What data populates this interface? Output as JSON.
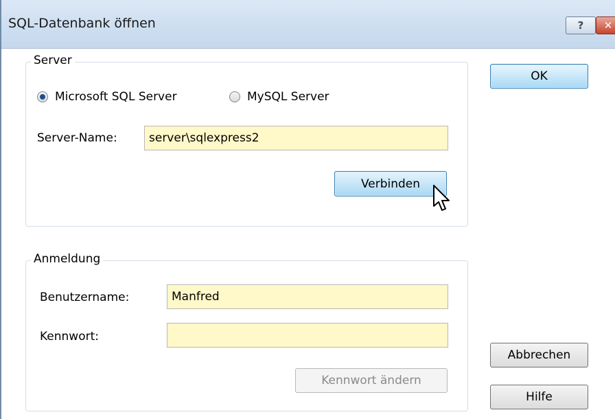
{
  "window": {
    "title": "SQL-Datenbank öffnen",
    "help_glyph": "?",
    "close_glyph": "✕"
  },
  "server_group": {
    "label": "Server",
    "radio_mssql": {
      "label": "Microsoft SQL Server",
      "checked": true
    },
    "radio_mysql": {
      "label": "MySQL Server",
      "checked": false
    },
    "server_name_label": "Server-Name:",
    "server_name_value": "server\\sqlexpress2",
    "connect_button": "Verbinden"
  },
  "login_group": {
    "label": "Anmeldung",
    "username_label": "Benutzername:",
    "username_value": "Manfred",
    "password_label": "Kennwort:",
    "password_value": "",
    "change_password_button": "Kennwort ändern"
  },
  "side_buttons": {
    "ok": "OK",
    "cancel": "Abbrechen",
    "help": "Hilfe"
  },
  "colors": {
    "input_bg": "#fff8c8",
    "titlebar": "#c4d7ec",
    "close": "#c8442c"
  }
}
